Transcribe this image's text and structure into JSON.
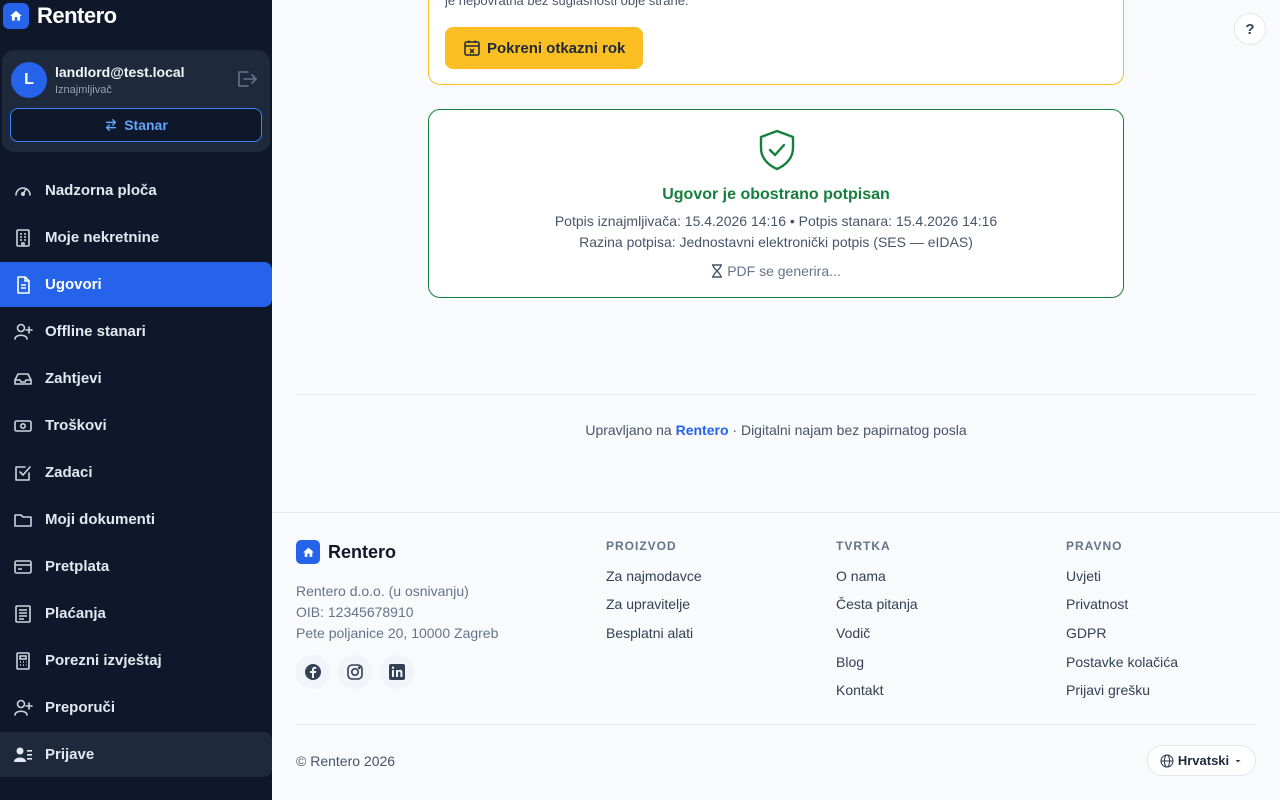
{
  "app": {
    "name": "Rentero"
  },
  "user": {
    "initial": "L",
    "email": "landlord@test.local",
    "role": "Iznajmljivač",
    "switch_label": "Stanar"
  },
  "nav": [
    {
      "label": "Nadzorna ploča",
      "icon": "gauge-icon"
    },
    {
      "label": "Moje nekretnine",
      "icon": "building-icon"
    },
    {
      "label": "Ugovori",
      "icon": "document-icon"
    },
    {
      "label": "Offline stanari",
      "icon": "user-plus-icon"
    },
    {
      "label": "Zahtjevi",
      "icon": "inbox-icon"
    },
    {
      "label": "Troškovi",
      "icon": "cash-icon"
    },
    {
      "label": "Zadaci",
      "icon": "checkbox-icon"
    },
    {
      "label": "Moji dokumenti",
      "icon": "folder-icon"
    },
    {
      "label": "Pretplata",
      "icon": "credit-card-icon"
    },
    {
      "label": "Plaćanja",
      "icon": "receipt-icon"
    },
    {
      "label": "Porezni izvještaj",
      "icon": "calculator-icon"
    },
    {
      "label": "Preporuči",
      "icon": "user-plus-icon"
    },
    {
      "label": "Prijave",
      "icon": "user-list-icon"
    }
  ],
  "nav_active": "Ugovori",
  "warning": {
    "text": "je nepovratna bez suglasnosti obje strane.",
    "button_label": "Pokreni otkazni rok"
  },
  "help_label": "?",
  "signed": {
    "title": "Ugovor je obostrano potpisan",
    "line1": "Potpis iznajmljivača: 15.4.2026 14:16 • Potpis stanara: 15.4.2026 14:16",
    "line2": "Razina potpisa: Jednostavni elektronički potpis (SES — eIDAS)",
    "pdf_status": "PDF se generira..."
  },
  "managed": {
    "prefix": "Upravljano na",
    "brand": "Rentero",
    "suffix": "· Digitalni najam bez papirnatog posla"
  },
  "footer": {
    "brand": "Rentero",
    "company": "Rentero d.o.o. (u osnivanju)",
    "oib": "OIB: 12345678910",
    "address": "Pete poljanice 20, 10000 Zagreb",
    "columns": [
      {
        "title": "PROIZVOD",
        "links": [
          "Za najmodavce",
          "Za upravitelje",
          "Besplatni alati"
        ]
      },
      {
        "title": "TVRTKA",
        "links": [
          "O nama",
          "Česta pitanja",
          "Vodič",
          "Blog",
          "Kontakt"
        ]
      },
      {
        "title": "PRAVNO",
        "links": [
          "Uvjeti",
          "Privatnost",
          "GDPR",
          "Postavke kolačića",
          "Prijavi grešku"
        ]
      }
    ],
    "copyright": "© Rentero 2026",
    "language": "Hrvatski"
  },
  "colors": {
    "accent": "#2563eb",
    "sidebar": "#0f172a",
    "success": "#15803d",
    "warning": "#fbbf24"
  }
}
